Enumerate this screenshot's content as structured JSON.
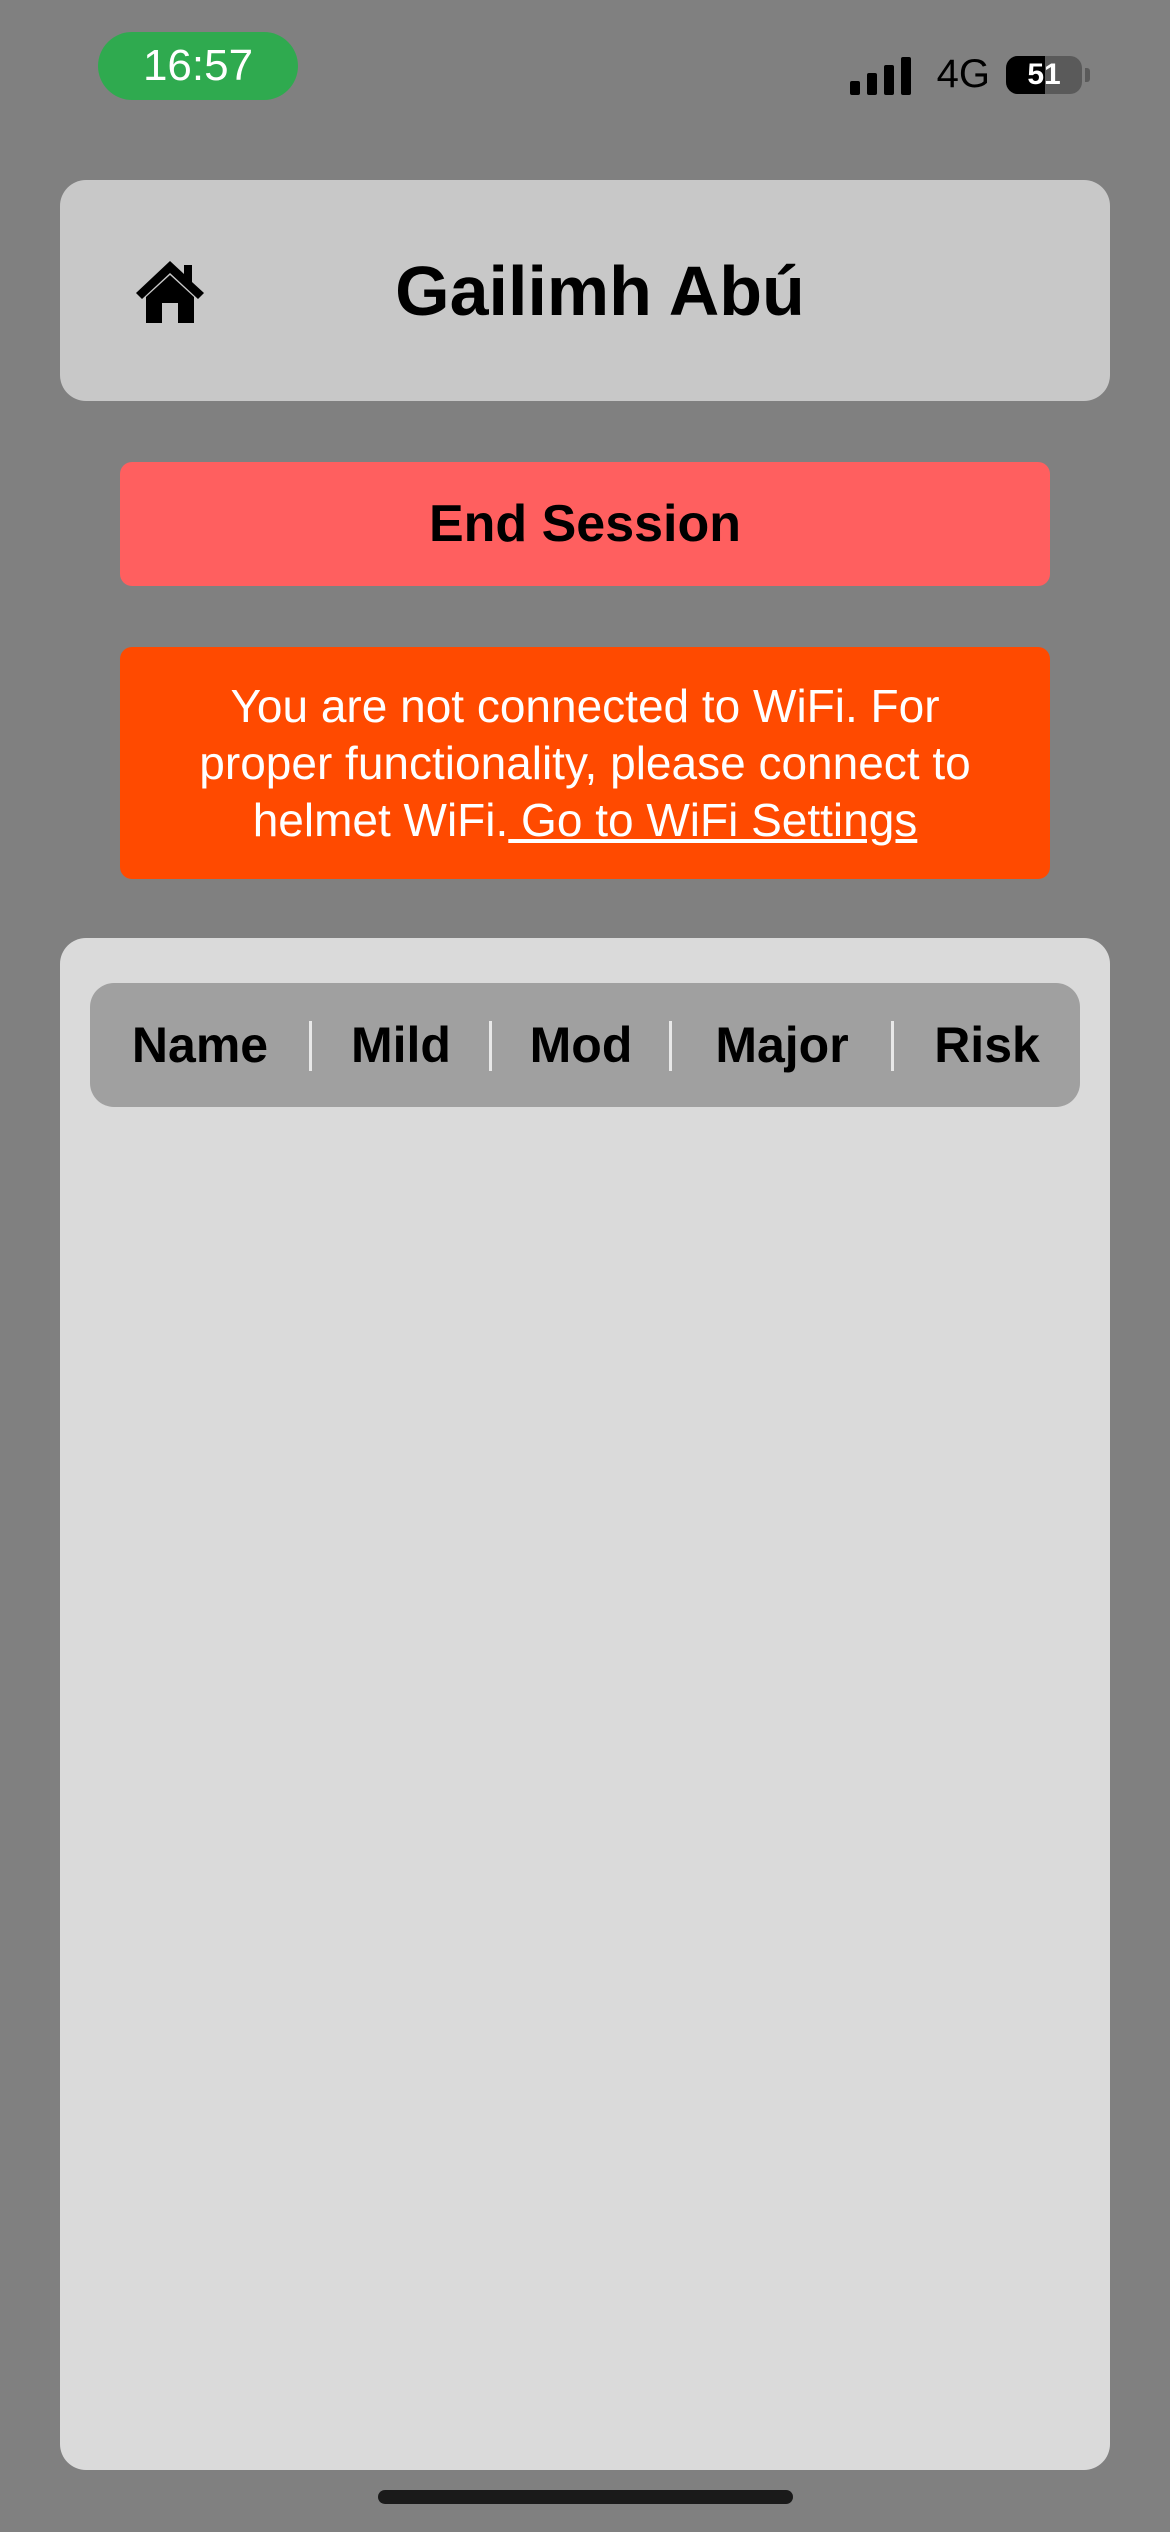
{
  "status_bar": {
    "time": "16:57",
    "network": "4G",
    "battery_level": "51",
    "battery_fraction": 0.51
  },
  "header": {
    "title": "Gailimh Abú",
    "home_icon": "home-icon"
  },
  "end_session_label": "End Session",
  "wifi_banner": {
    "message": "You are not connected to WiFi. For proper functionality, please connect to helmet WiFi.",
    "link_text": " Go to WiFi Settings"
  },
  "table": {
    "columns": [
      "Name",
      "Mild",
      "Mod",
      "Major",
      "Risk"
    ],
    "rows": []
  },
  "colors": {
    "background": "#808080",
    "time_pill": "#2faa4f",
    "end_button": "#ff5f5f",
    "wifi_banner": "#ff4a00",
    "panel": "#dadada",
    "table_header": "#a0a0a0"
  }
}
